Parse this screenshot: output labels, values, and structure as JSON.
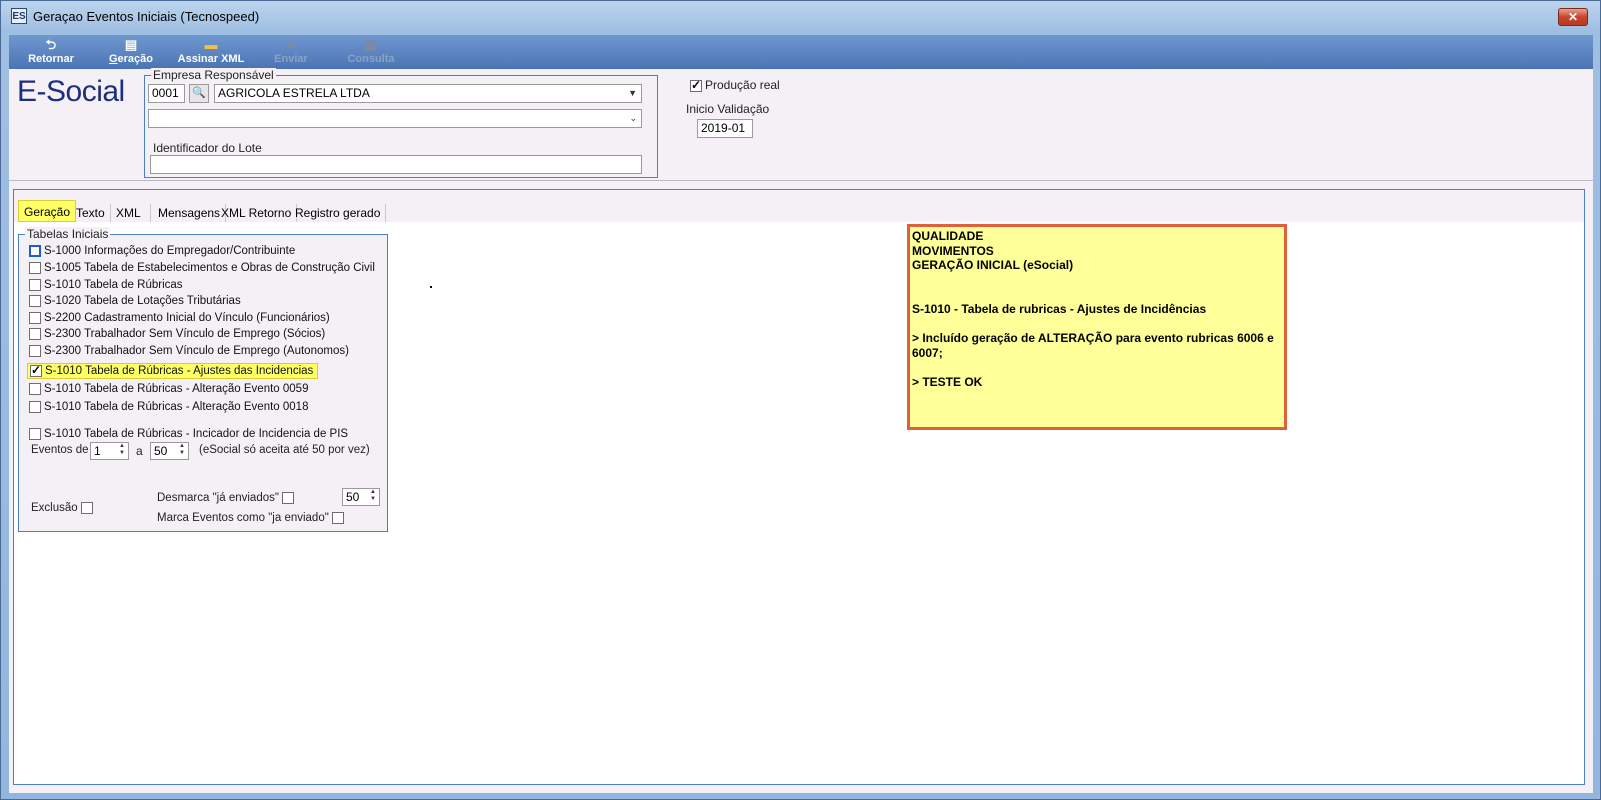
{
  "window": {
    "title": "Geraçao Eventos Iniciais (Tecnospeed)",
    "close_label": "✕",
    "icon_label": "ES"
  },
  "toolbar": {
    "buttons": [
      {
        "label": "Retornar",
        "icon": "⮌",
        "enabled": true
      },
      {
        "label": "Geração",
        "icon": "▤",
        "enabled": true
      },
      {
        "label": "Assinar XML",
        "icon": "▬",
        "enabled": true
      },
      {
        "label": "Enviar",
        "icon": "■",
        "enabled": false
      },
      {
        "label": "Consulta",
        "icon": "▦",
        "enabled": false
      }
    ]
  },
  "header": {
    "logo": "E-Social",
    "empresa_legend": "Empresa Responsável",
    "empresa_code": "0001",
    "empresa_name": "AGRICOLA ESTRELA LTDA",
    "second_combo_value": "",
    "identificador_label": "Identificador do Lote",
    "identificador_value": "",
    "producao_label": "Produção real",
    "producao_checked": true,
    "inicio_label": "Inicio Validação",
    "inicio_value": "2019-01"
  },
  "tabs": [
    {
      "label": "Geração",
      "active": true
    },
    {
      "label": "Texto",
      "active": false
    },
    {
      "label": "XML",
      "active": false
    },
    {
      "label": "Mensagens",
      "active": false
    },
    {
      "label": "XML Retorno",
      "active": false
    },
    {
      "label": "Registro gerado",
      "active": false
    }
  ],
  "tabelas": {
    "legend": "Tabelas Iniciais",
    "items": [
      {
        "label": "S-1000 Informações do Empregador/Contribuinte",
        "checked": false
      },
      {
        "label": "S-1005 Tabela de Estabelecimentos e Obras de Construção Civil",
        "checked": false
      },
      {
        "label": "S-1010 Tabela de Rúbricas",
        "checked": false
      },
      {
        "label": "S-1020 Tabela de Lotações Tributárias",
        "checked": false
      },
      {
        "label": "S-2200 Cadastramento Inicial do Vínculo (Funcionários)",
        "checked": false
      },
      {
        "label": "S-2300 Trabalhador Sem Vínculo de Emprego (Sócios)",
        "checked": false
      },
      {
        "label": "S-2300 Trabalhador Sem Vínculo de Emprego (Autonomos)",
        "checked": false
      },
      {
        "label": "S-1010 Tabela de Rúbricas - Ajustes das Incidencias",
        "checked": true
      },
      {
        "label": "S-1010 Tabela de Rúbricas - Alteração Evento 0059",
        "checked": false
      },
      {
        "label": "S-1010 Tabela de Rúbricas - Alteração Evento 0018",
        "checked": false
      },
      {
        "label": "S-1010 Tabela de Rúbricas - Incicador de Incidencia de PIS",
        "checked": false
      }
    ],
    "eventos_label": "Eventos de",
    "eventos_from": "1",
    "eventos_sep": "a",
    "eventos_to": "50",
    "eventos_note": "(eSocial só aceita até 50 por vez)",
    "exclusao_label": "Exclusão",
    "desmarca_label": "Desmarca \"já enviados\"",
    "desmarca_count": "50",
    "marca_label": "Marca Eventos como \"ja enviado\""
  },
  "note": {
    "lines": [
      "QUALIDADE",
      "MOVIMENTOS",
      "GERAÇÃO INICIAL (eSocial)",
      "",
      "",
      "S-1010 - Tabela de rubricas - Ajustes de Incidências",
      "",
      "> Incluído geração de ALTERAÇÃO para evento rubricas 6006 e 6007;",
      "",
      "> TESTE OK"
    ]
  },
  "colors": {
    "highlight": "#ffff66",
    "note_bg": "#ffff99",
    "note_border": "#e0603c",
    "frame_border": "#4a7fc1"
  }
}
